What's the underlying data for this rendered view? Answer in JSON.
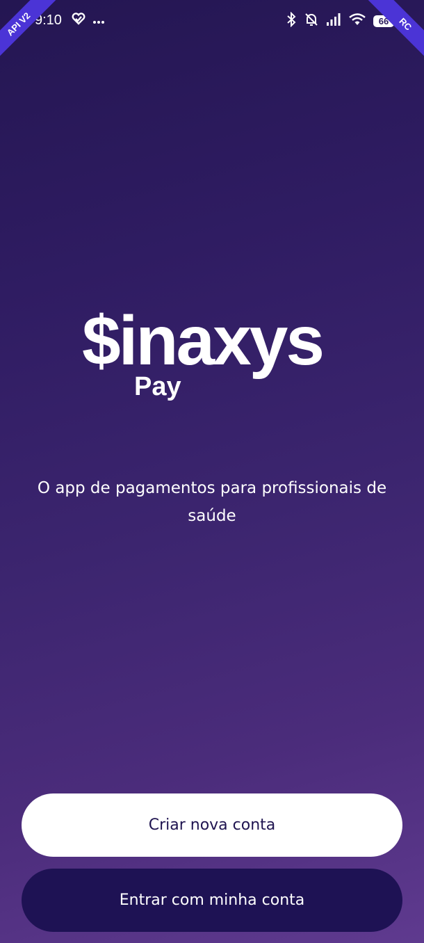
{
  "status_bar": {
    "time": "9:10",
    "battery_level": "66",
    "left_icons": [
      "heart-health-icon",
      "more-dots-icon"
    ],
    "right_icons": [
      "bluetooth-icon",
      "muted-bell-icon",
      "signal-icon",
      "wifi-icon",
      "battery-icon"
    ]
  },
  "debug_ribbons": {
    "left": "API V2",
    "right": "RC"
  },
  "brand": {
    "wordmark": "$inaxys",
    "sub": "Pay"
  },
  "tagline": "O app de pagamentos para profissionais de saúde",
  "actions": {
    "create_account": "Criar nova conta",
    "sign_in": "Entrar com minha conta"
  },
  "colors": {
    "background_top": "#241652",
    "background_bottom": "#5f3a8f",
    "primary_button_bg": "#ffffff",
    "primary_button_text": "#1f1450",
    "secondary_button_bg": "#1e1254",
    "secondary_button_text": "#ffffff",
    "ribbon": "#4b34d6"
  }
}
